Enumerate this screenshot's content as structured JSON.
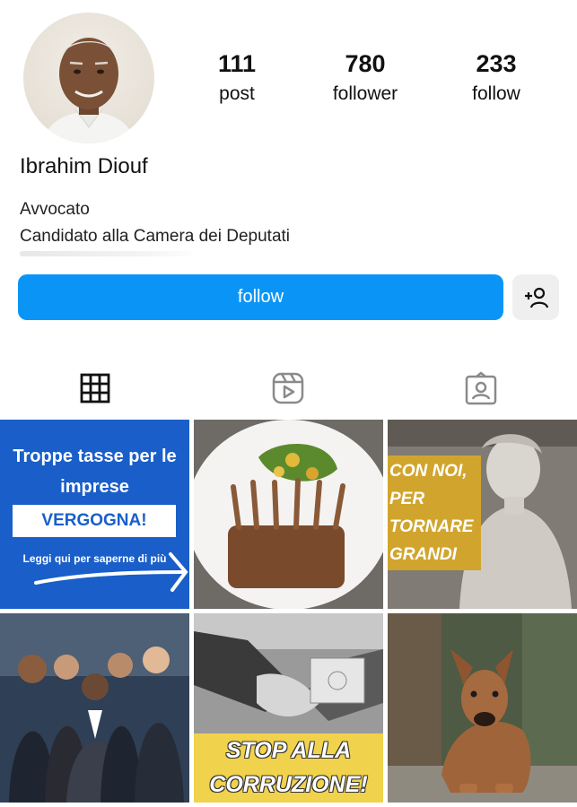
{
  "profile": {
    "name": "Ibrahim Diouf",
    "bio_line1": "Avvocato",
    "bio_line2": "Candidato alla Camera dei Deputati"
  },
  "stats": {
    "posts": {
      "value": "111",
      "label": "post"
    },
    "followers": {
      "value": "780",
      "label": "follower"
    },
    "following": {
      "value": "233",
      "label": "follow"
    }
  },
  "actions": {
    "follow_label": "follow",
    "add_friend_icon": "add-person-icon"
  },
  "tabs": [
    {
      "icon": "grid-icon",
      "active": true
    },
    {
      "icon": "reels-icon",
      "active": false
    },
    {
      "icon": "tagged-icon",
      "active": false
    }
  ],
  "posts": [
    {
      "title": "Troppe tasse per le imprese",
      "badge": "VERGOGNA!",
      "cta": "Leggi qui per saperne di più"
    },
    {
      "subject": "food-photo"
    },
    {
      "lines": [
        "CON NOI,",
        "PER",
        "TORNARE",
        "GRANDI"
      ]
    },
    {
      "subject": "business-team-photo"
    },
    {
      "lines": [
        "STOP ALLA",
        "CORRUZIONE!"
      ]
    },
    {
      "subject": "dog-photo"
    }
  ],
  "colors": {
    "primary_button": "#0a95f6",
    "post1_bg": "#1a5fc9",
    "post3_box": "#d1a52d",
    "post5_band": "#f0d24c"
  }
}
